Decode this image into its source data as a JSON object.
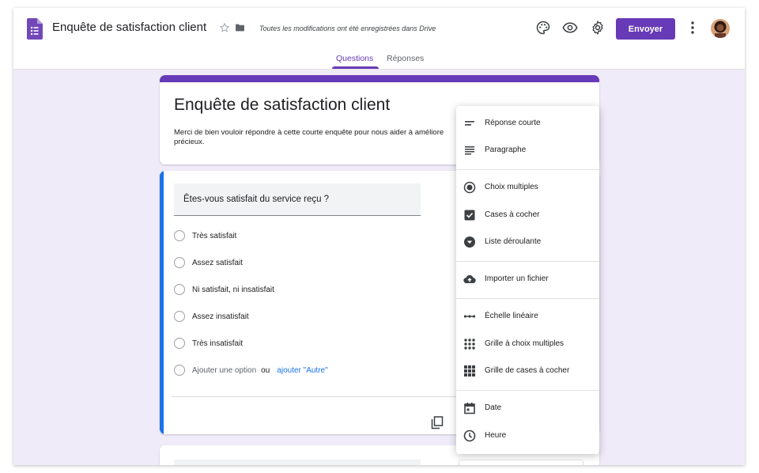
{
  "header": {
    "title": "Enquête de satisfaction client",
    "save_status": "Toutes les modifications ont été enregistrées dans Drive",
    "send_label": "Envoyer"
  },
  "tabs": [
    {
      "label": "Questions",
      "active": true
    },
    {
      "label": "Réponses",
      "active": false
    }
  ],
  "form": {
    "title": "Enquête de satisfaction client",
    "description": "Merci de bien vouloir répondre à cette courte enquête pour nous aider à améliore précieux."
  },
  "question": {
    "text": "Êtes-vous satisfait du service reçu ?",
    "options": [
      "Très satisfait",
      "Assez satisfait",
      "Ni satisfait, ni insatisfait",
      "Assez insatisfait",
      "Très insatisfait"
    ],
    "add_option": "Ajouter une option",
    "or": "ou",
    "add_other": "ajouter \"Autre\""
  },
  "type_menu": {
    "items": [
      {
        "label": "Réponse courte",
        "icon": "short-answer-icon"
      },
      {
        "label": "Paragraphe",
        "icon": "paragraph-icon"
      },
      {
        "label": "Choix multiples",
        "icon": "radio-button-icon"
      },
      {
        "label": "Cases à cocher",
        "icon": "checkbox-icon"
      },
      {
        "label": "Liste déroulante",
        "icon": "dropdown-icon"
      },
      {
        "label": "Importer un fichier",
        "icon": "cloud-upload-icon"
      },
      {
        "label": "Échelle linéaire",
        "icon": "linear-scale-icon"
      },
      {
        "label": "Grille à choix multiples",
        "icon": "dots-grid-icon"
      },
      {
        "label": "Grille de cases à cocher",
        "icon": "checkbox-grid-icon"
      },
      {
        "label": "Date",
        "icon": "calendar-icon"
      },
      {
        "label": "Heure",
        "icon": "clock-icon"
      }
    ]
  },
  "colors": {
    "brand": "#673ab7",
    "focus": "#1a73e8",
    "background": "#efebf9"
  }
}
